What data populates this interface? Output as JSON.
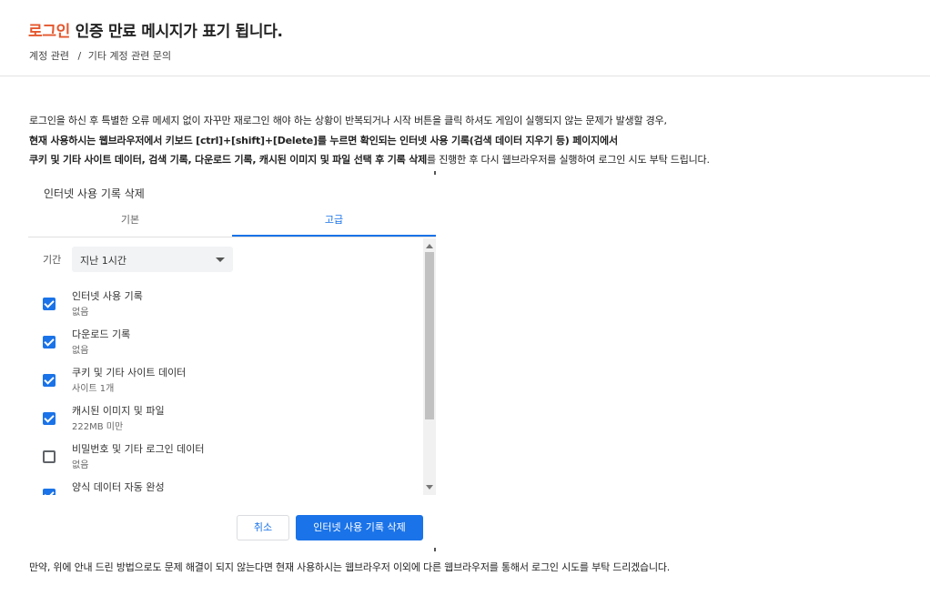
{
  "header": {
    "title_accent": "로그인",
    "title_rest": " 인증 만료 메시지가 표기 됩니다.",
    "breadcrumb": [
      "계정 관련",
      "기타 계정 관련 문의"
    ],
    "breadcrumb_separator": "/"
  },
  "body": {
    "para1": "로그인을 하신 후 특별한 오류 메세지 없이 자꾸만 재로그인 해야 하는 상황이 반복되거나 시작 버튼을 클릭 하셔도 게임이 실행되지 않는 문제가 발생할 경우,",
    "para2": "현재 사용하시는 웹브라우저에서 키보드 [ctrl]+[shift]+[Delete]를 누르면  확인되는 인터넷 사용 기록(검색 데이터 지우기 등) 페이지에서",
    "para3_bold": "쿠키 및 기타 사이트 데이터, 검색 기록, 다운로드 기록, 캐시된 이미지 및 파일 선택 후 기록 삭제",
    "para3_rest": "를 진행한 후 다시 웹브라우저를 실행하여 로그인 시도 부탁 드립니다.",
    "para4": "만약, 위에 안내 드린 방법으로도 문제 해결이 되지 않는다면 현재 사용하시는 웹브라우저 이외에 다른 웹브라우저를 통해서 로그인 시도를 부탁 드리겠습니다."
  },
  "dialog": {
    "title": "인터넷 사용 기록 삭제",
    "tabs": [
      {
        "label": "기본",
        "active": false
      },
      {
        "label": "고급",
        "active": true
      }
    ],
    "period_label": "기간",
    "period_value": "지난 1시간",
    "items": [
      {
        "label": "인터넷 사용 기록",
        "sub": "없음",
        "checked": true
      },
      {
        "label": "다운로드 기록",
        "sub": "없음",
        "checked": true
      },
      {
        "label": "쿠키 및 기타 사이트 데이터",
        "sub": "사이트 1개",
        "checked": true
      },
      {
        "label": "캐시된 이미지 및 파일",
        "sub": "222MB 미만",
        "checked": true
      },
      {
        "label": "비밀번호 및 기타 로그인 데이터",
        "sub": "없음",
        "checked": false
      },
      {
        "label": "양식 데이터 자동 완성",
        "sub": "",
        "checked": true
      }
    ],
    "cancel_label": "취소",
    "confirm_label": "인터넷 사용 기록 삭제"
  },
  "colors": {
    "accent": "#e4572e",
    "primary": "#1a73e8"
  }
}
